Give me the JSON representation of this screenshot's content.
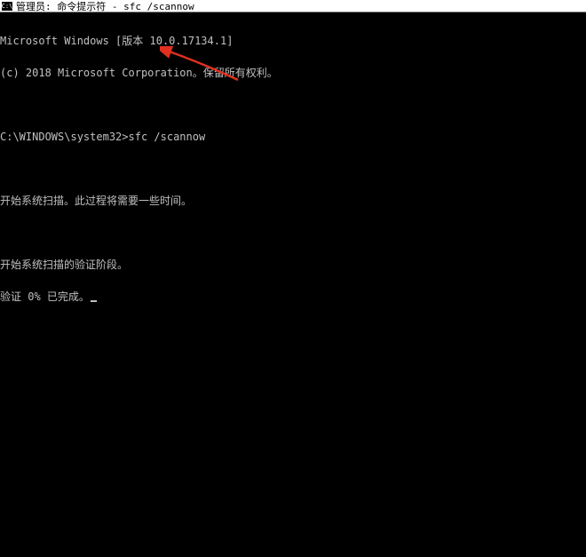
{
  "titlebar": {
    "text": "管理员: 命令提示符 - sfc  /scannow"
  },
  "terminal": {
    "line1": "Microsoft Windows [版本 10.0.17134.1]",
    "line2": "(c) 2018 Microsoft Corporation。保留所有权利。",
    "prompt": "C:\\WINDOWS\\system32>",
    "command": "sfc /scannow",
    "line4": "开始系统扫描。此过程将需要一些时间。",
    "line5": "开始系统扫描的验证阶段。",
    "line6": "验证 0% 已完成。"
  }
}
